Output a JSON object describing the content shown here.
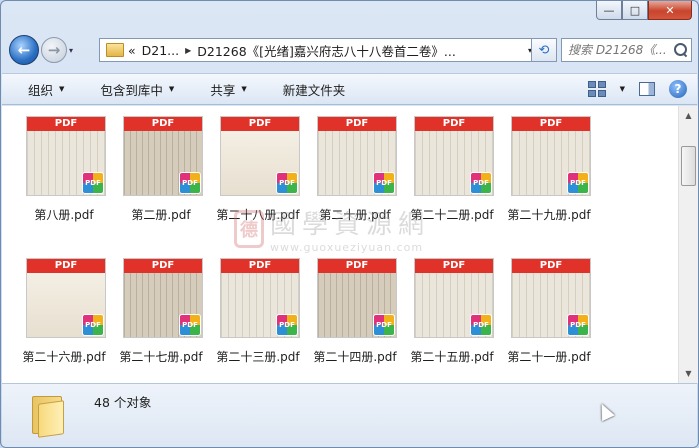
{
  "window": {
    "minimize_glyph": "—",
    "maximize_glyph": "□",
    "close_glyph": "✕"
  },
  "nav": {
    "back_glyph": "←",
    "forward_glyph": "→",
    "history_glyph": "▾",
    "breadcrumb_prefix": "«",
    "crumb1": "D21...",
    "crumb2": "D21268《[光绪]嘉兴府志八十八卷首二卷》...",
    "dropdown_glyph": "▾",
    "refresh_glyph": "⟲",
    "search_placeholder": "搜索 D21268《..."
  },
  "toolbar": {
    "organize": "组织",
    "include_in_library": "包含到库中",
    "share": "共享",
    "new_folder": "新建文件夹",
    "arrow": "▼",
    "help_glyph": "?"
  },
  "thumb_header": "PDF",
  "badge_label": "PDF",
  "files": [
    {
      "name": "第八册.pdf",
      "style": "lined"
    },
    {
      "name": "第二册.pdf",
      "style": "dark"
    },
    {
      "name": "第二十八册.pdf",
      "style": "plain"
    },
    {
      "name": "第二十册.pdf",
      "style": "lined"
    },
    {
      "name": "第二十二册.pdf",
      "style": "lined"
    },
    {
      "name": "第二十九册.pdf",
      "style": "lined"
    },
    {
      "name": "第二十六册.pdf",
      "style": "plain"
    },
    {
      "name": "第二十七册.pdf",
      "style": "dark"
    },
    {
      "name": "第二十三册.pdf",
      "style": "lined"
    },
    {
      "name": "第二十四册.pdf",
      "style": "dark"
    },
    {
      "name": "第二十五册.pdf",
      "style": "lined"
    },
    {
      "name": "第二十一册.pdf",
      "style": "lined"
    }
  ],
  "watermark": {
    "seal": "德",
    "cn": "國學資源網",
    "url": "www.guoxueziyuan.com"
  },
  "status": {
    "count": "48 个对象"
  }
}
